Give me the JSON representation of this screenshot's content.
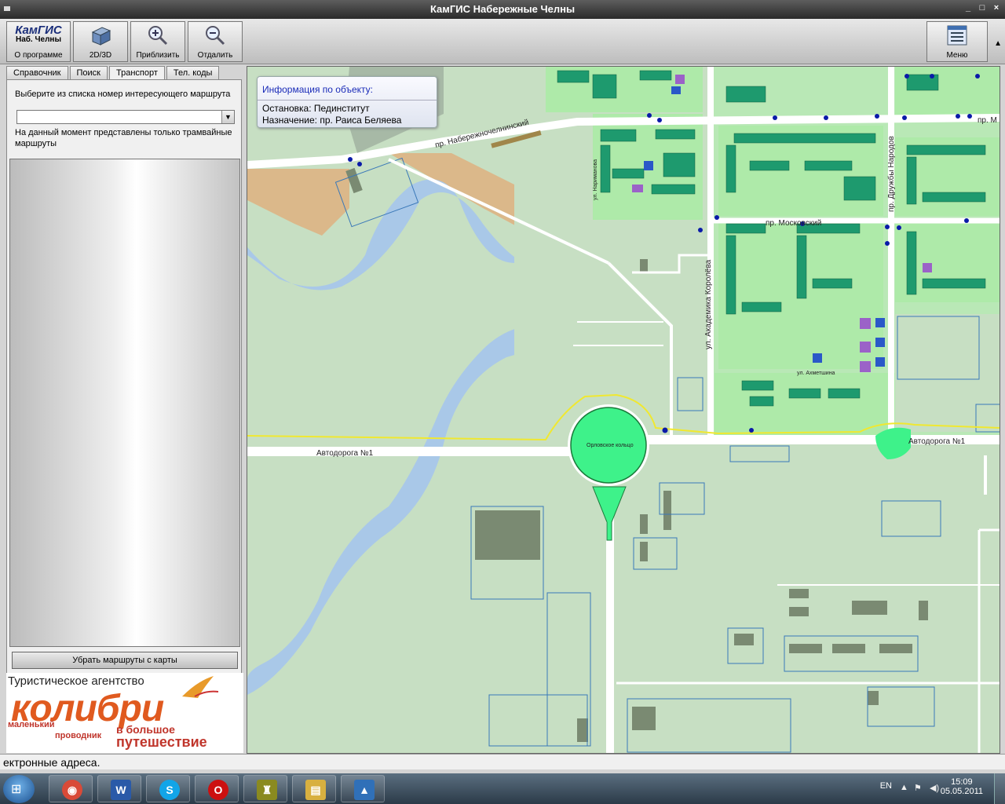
{
  "window": {
    "title": "КамГИС Набережные Челны",
    "controls": [
      "_",
      "□",
      "×"
    ]
  },
  "toolbar": {
    "logo_text": "КамГИС",
    "logo_sub": "Наб. Челны",
    "about_label": "О программе",
    "view_label": "2D/3D",
    "zoom_in_label": "Приблизить",
    "zoom_out_label": "Отдалить",
    "menu_label": "Меню",
    "scroll_glyph": "▲"
  },
  "left_panel": {
    "tabs": [
      {
        "label": "Справочник",
        "active": false
      },
      {
        "label": "Поиск",
        "active": false
      },
      {
        "label": "Транспорт",
        "active": true
      },
      {
        "label": "Тел. коды",
        "active": false
      }
    ],
    "prompt": "Выберите из списка номер интересующего маршрута",
    "route_select_value": "",
    "combo_arrow": "▼",
    "note": "На данный момент представлены только трамвайные маршруты",
    "clear_button": "Убрать маршруты с карты"
  },
  "ad": {
    "line1": "Туристическое агентство",
    "brand": "колибри",
    "line3": "маленький",
    "line4": "проводник",
    "line5": "в большое",
    "line6": "путешествие",
    "brand_color": "#e05a1f"
  },
  "info_popup": {
    "header": "Информация по объекту:",
    "row1": "Остановка: Пединститут",
    "row2": "Назначение: пр. Раиса Беляева"
  },
  "map_labels": {
    "street_naberezhnochelninsky": "пр. Набережночелнинский",
    "street_moskovsky": "пр. Московский",
    "street_korolev": "ул. Академика Королёва",
    "street_druzhby": "пр. Дружбы Народов",
    "street_narimanova": "ул. Нариманова",
    "street_akhmetshina": "ул. Ахметшина",
    "road1_left": "Автодорога №1",
    "road1_right": "Автодорога №1",
    "circle": "Орловское кольцо",
    "street_m_cut": "пр. М"
  },
  "colors": {
    "map_base": "#c7dfc3",
    "river": "#a9c8e8",
    "sand": "#dbb88a",
    "block": "#a8f0b0",
    "building": "#1e9a6e",
    "circle": "#3ef28a",
    "stop": "#0a1aa8",
    "route": "#f0e830"
  },
  "status": {
    "text": "ектронные адреса."
  },
  "taskbar": {
    "start_glyph": "⊞",
    "apps": [
      {
        "name": "chrome",
        "glyph": "◉",
        "color": "#d94a38"
      },
      {
        "name": "word",
        "glyph": "W",
        "color": "#2a5aa8"
      },
      {
        "name": "skype",
        "glyph": "S",
        "color": "#12a5e8"
      },
      {
        "name": "opera",
        "glyph": "O",
        "color": "#cc1010"
      },
      {
        "name": "game",
        "glyph": "♜",
        "color": "#8a8a20"
      },
      {
        "name": "explorer",
        "glyph": "▤",
        "color": "#d8b040"
      },
      {
        "name": "kamgis",
        "glyph": "▲",
        "color": "#3070b8"
      }
    ],
    "lang": "EN",
    "tray_up": "▲",
    "tray_icon2": "⚑",
    "tray_volume": "◀)",
    "time": "15:09",
    "date": "05.05.2011"
  }
}
